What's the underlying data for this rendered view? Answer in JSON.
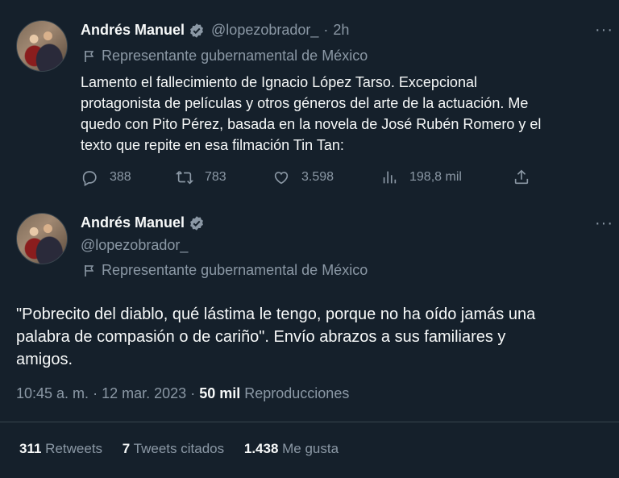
{
  "tweet1": {
    "name": "Andrés Manuel",
    "handle": "@lopezobrador_",
    "separator": "·",
    "time": "2h",
    "label": "Representante gubernamental de México",
    "text_lines": [
      "Lamento el fallecimiento de Ignacio López Tarso. Excepcional",
      "protagonista de películas y otros géneros del arte de la actuación. Me",
      "quedo con Pito Pérez, basada en la novela de José Rubén Romero y el",
      "texto que repite en esa filmación Tin Tan:"
    ],
    "replies": "388",
    "retweets": "783",
    "likes": "3.598",
    "views": "198,8 mil"
  },
  "tweet2": {
    "name": "Andrés Manuel",
    "handle": "@lopezobrador_",
    "label": "Representante gubernamental de México",
    "text_lines": [
      "\"Pobrecito del diablo, qué lástima le tengo, porque no ha oído jamás una",
      "palabra de compasión o de cariño\". Envío abrazos a sus familiares y",
      "amigos."
    ],
    "time": "10:45 a. m.",
    "date_sep": "·",
    "date": "12 mar. 2023",
    "views_sep": "·",
    "views_count": "50 mil",
    "views_label": "Reproducciones",
    "stats": {
      "retweets_count": "311",
      "retweets_label": "Retweets",
      "quotes_count": "7",
      "quotes_label": "Tweets citados",
      "likes_count": "1.438",
      "likes_label": "Me gusta"
    }
  },
  "more_glyph": "···",
  "colors": {
    "background": "#15202b",
    "text": "#f7f9f9",
    "secondary": "#8b98a5",
    "verified": "#8b98a5",
    "divider": "#38444d"
  },
  "icons": [
    "verified-badge-icon",
    "government-flag-icon",
    "reply-icon",
    "retweet-icon",
    "like-icon",
    "views-icon",
    "share-icon",
    "more-icon"
  ]
}
